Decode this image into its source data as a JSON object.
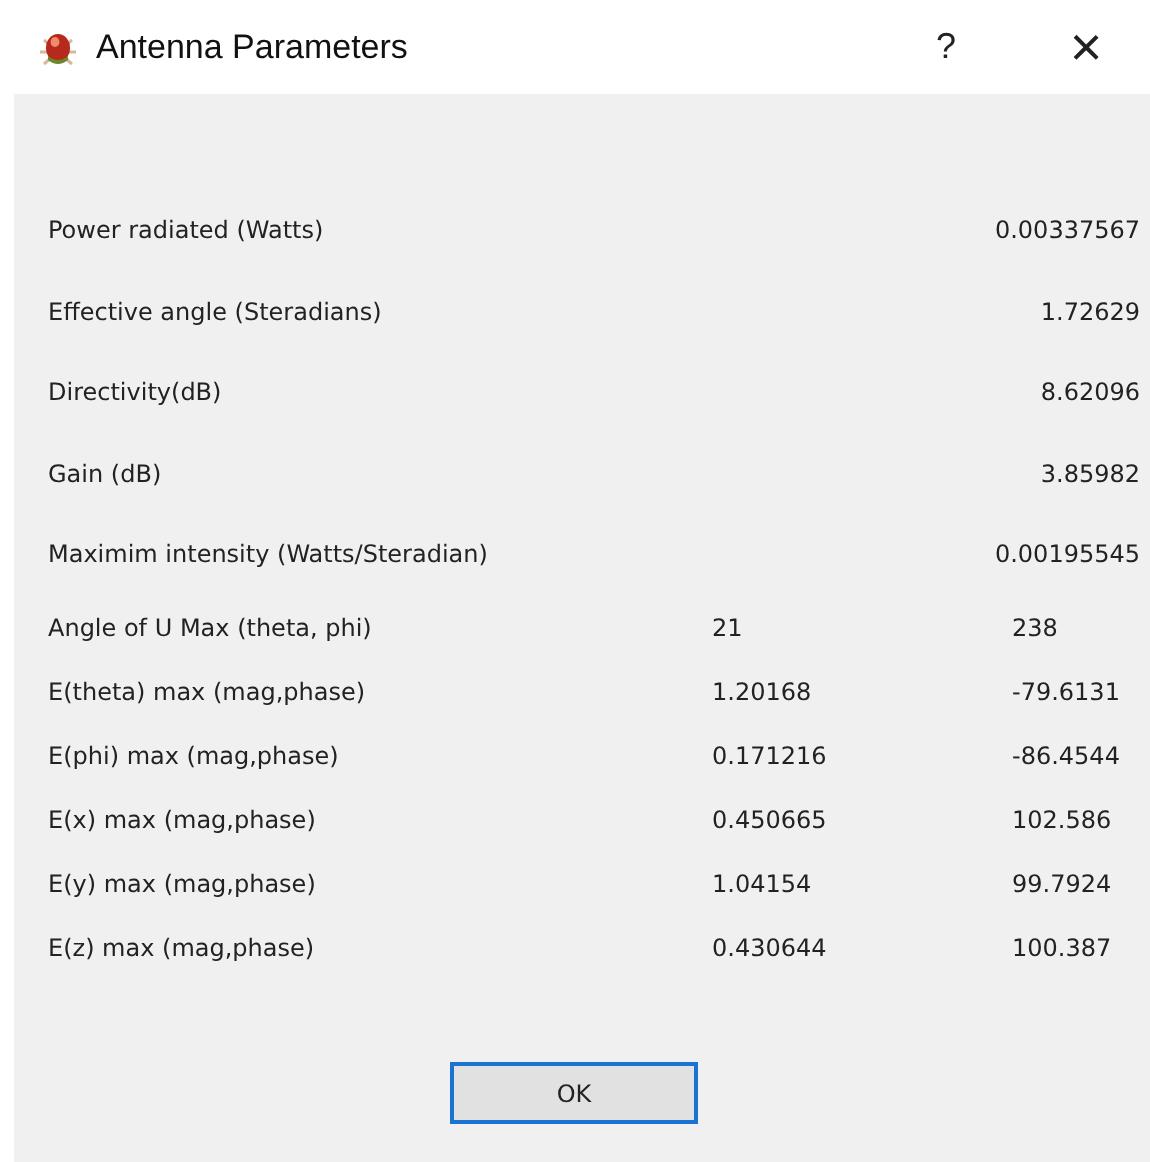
{
  "window": {
    "title": "Antenna Parameters",
    "help_button": "?",
    "close_button": "×"
  },
  "rows": [
    {
      "kind": "single",
      "label": "Power radiated (Watts)",
      "value": "0.00337567"
    },
    {
      "kind": "single",
      "label": "Effective angle (Steradians)",
      "value": "1.72629"
    },
    {
      "kind": "single",
      "label": "Directivity(dB)",
      "value": "8.62096"
    },
    {
      "kind": "single",
      "label": "Gain (dB)",
      "value": "3.85982"
    },
    {
      "kind": "single",
      "label": "Maximim intensity (Watts/Steradian)",
      "value": "0.00195545"
    },
    {
      "kind": "pair",
      "label": "Angle of U Max (theta, phi)",
      "values": [
        "21",
        "238"
      ]
    },
    {
      "kind": "pair",
      "label": "E(theta) max (mag,phase)",
      "values": [
        "1.20168",
        "-79.6131"
      ]
    },
    {
      "kind": "pair",
      "label": "E(phi) max (mag,phase)",
      "values": [
        "0.171216",
        "-86.4544"
      ]
    },
    {
      "kind": "pair",
      "label": "E(x) max (mag,phase)",
      "values": [
        "0.450665",
        "102.586"
      ]
    },
    {
      "kind": "pair",
      "label": "E(y) max (mag,phase)",
      "values": [
        "1.04154",
        "99.7924"
      ]
    },
    {
      "kind": "pair",
      "label": "E(z) max (mag,phase)",
      "values": [
        "0.430644",
        "100.387"
      ]
    }
  ],
  "buttons": [
    {
      "label": "OK",
      "focused": true
    }
  ]
}
